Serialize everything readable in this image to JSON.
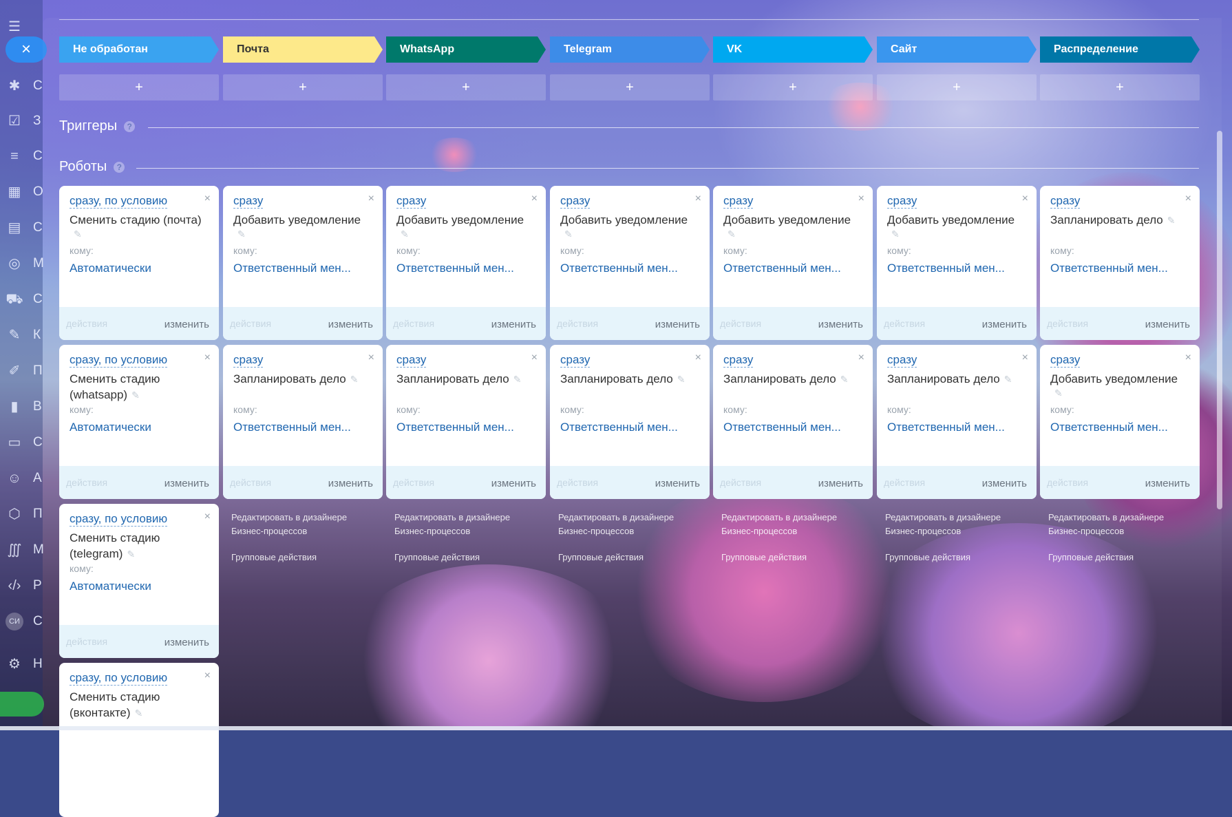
{
  "sidebar": {
    "letters": [
      "С",
      "З",
      "С",
      "О",
      "С",
      "М",
      "С",
      "К",
      "П",
      "В",
      "С",
      "А",
      "П",
      "М",
      "Р",
      "С",
      "Н"
    ],
    "avatar": "СИ"
  },
  "colors": {
    "ne_obrabotan": "#3aa3f0",
    "pochta": "#fde98a",
    "whatsapp": "#00796b",
    "telegram": "#3d8ce8",
    "vk": "#00a8f0",
    "site": "#3a96ee",
    "raspredelenie": "#0077a8"
  },
  "stages": [
    {
      "label": "Не обработан"
    },
    {
      "label": "Почта"
    },
    {
      "label": "WhatsApp"
    },
    {
      "label": "Telegram"
    },
    {
      "label": "VK"
    },
    {
      "label": "Сайт"
    },
    {
      "label": "Распределение"
    }
  ],
  "add_label": "+",
  "sections": {
    "triggers": "Триггеры",
    "robots": "Роботы",
    "help": "?"
  },
  "common": {
    "to_label": "кому:",
    "actions_label": "действия",
    "edit_label": "изменить",
    "close": "×",
    "designer_link": "Редактировать в дизайнере Бизнес-процессов",
    "group_actions": "Групповые действия"
  },
  "columns": [
    {
      "cards": [
        {
          "cond": "сразу, по условию",
          "title": "Сменить стадию (почта)",
          "resp": "Автоматически"
        },
        {
          "cond": "сразу, по условию",
          "title": "Сменить стадию (whatsapp)",
          "resp": "Автоматически"
        },
        {
          "cond": "сразу, по условию",
          "title": "Сменить стадию (telegram)",
          "resp": "Автоматически"
        },
        {
          "cond": "сразу, по условию",
          "title": "Сменить стадию (вконтакте)",
          "resp": ""
        }
      ]
    },
    {
      "cards": [
        {
          "cond": "сразу",
          "title": "Добавить уведомление",
          "resp": "Ответственный мен..."
        },
        {
          "cond": "сразу",
          "title": "Запланировать дело",
          "resp": "Ответственный мен..."
        }
      ]
    },
    {
      "cards": [
        {
          "cond": "сразу",
          "title": "Добавить уведомление",
          "resp": "Ответственный мен..."
        },
        {
          "cond": "сразу",
          "title": "Запланировать дело",
          "resp": "Ответственный мен..."
        }
      ]
    },
    {
      "cards": [
        {
          "cond": "сразу",
          "title": "Добавить уведомление",
          "resp": "Ответственный мен..."
        },
        {
          "cond": "сразу",
          "title": "Запланировать дело",
          "resp": "Ответственный мен..."
        }
      ]
    },
    {
      "cards": [
        {
          "cond": "сразу",
          "title": "Добавить уведомление",
          "resp": "Ответственный мен..."
        },
        {
          "cond": "сразу",
          "title": "Запланировать дело",
          "resp": "Ответственный мен..."
        }
      ]
    },
    {
      "cards": [
        {
          "cond": "сразу",
          "title": "Добавить уведомление",
          "resp": "Ответственный мен..."
        },
        {
          "cond": "сразу",
          "title": "Запланировать дело",
          "resp": "Ответственный мен..."
        }
      ]
    },
    {
      "cards": [
        {
          "cond": "сразу",
          "title": "Запланировать дело",
          "resp": "Ответственный мен..."
        },
        {
          "cond": "сразу",
          "title": "Добавить уведомление",
          "resp": "Ответственный мен..."
        }
      ]
    }
  ]
}
